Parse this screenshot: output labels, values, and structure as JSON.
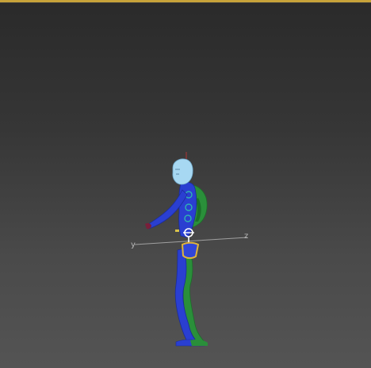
{
  "viewport": {
    "axis_labels": {
      "y": "y",
      "z": "z"
    },
    "colors": {
      "top_border": "#c7a23a",
      "background_top": "#2a2a2a",
      "background_bottom": "#545454",
      "head": "#a7d8f2",
      "body_blue": "#2a3fd1",
      "body_green": "#2a8f3a",
      "pelvis_yellow": "#e0b43a",
      "grid_line": "#9a9a9a",
      "gizmo": "#ffffff"
    }
  }
}
